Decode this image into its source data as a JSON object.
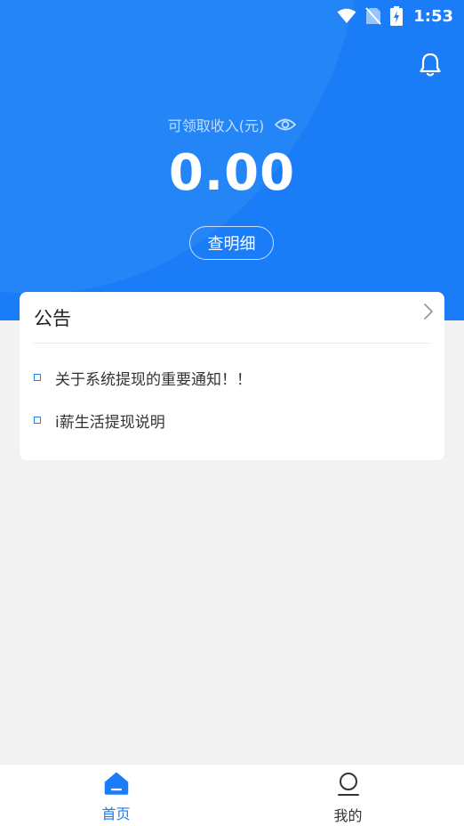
{
  "status_bar": {
    "time": "1:53",
    "icons": [
      "wifi-icon",
      "no-sim-icon",
      "battery-charging-icon"
    ]
  },
  "header": {
    "notification_icon": "bell-icon",
    "balance_label": "可领取收入(元)",
    "visibility_icon": "eye-icon",
    "balance_value": "0.00",
    "detail_button_label": "查明细"
  },
  "notice": {
    "title": "公告",
    "items": [
      {
        "text": "关于系统提现的重要通知！！"
      },
      {
        "text": "i薪生活提现说明"
      }
    ]
  },
  "bottom_nav": {
    "items": [
      {
        "label": "首页",
        "icon": "home-icon",
        "active": true
      },
      {
        "label": "我的",
        "icon": "profile-icon",
        "active": false
      }
    ]
  },
  "colors": {
    "primary": "#1a7cf6",
    "background": "#f2f2f2",
    "card": "#ffffff"
  }
}
